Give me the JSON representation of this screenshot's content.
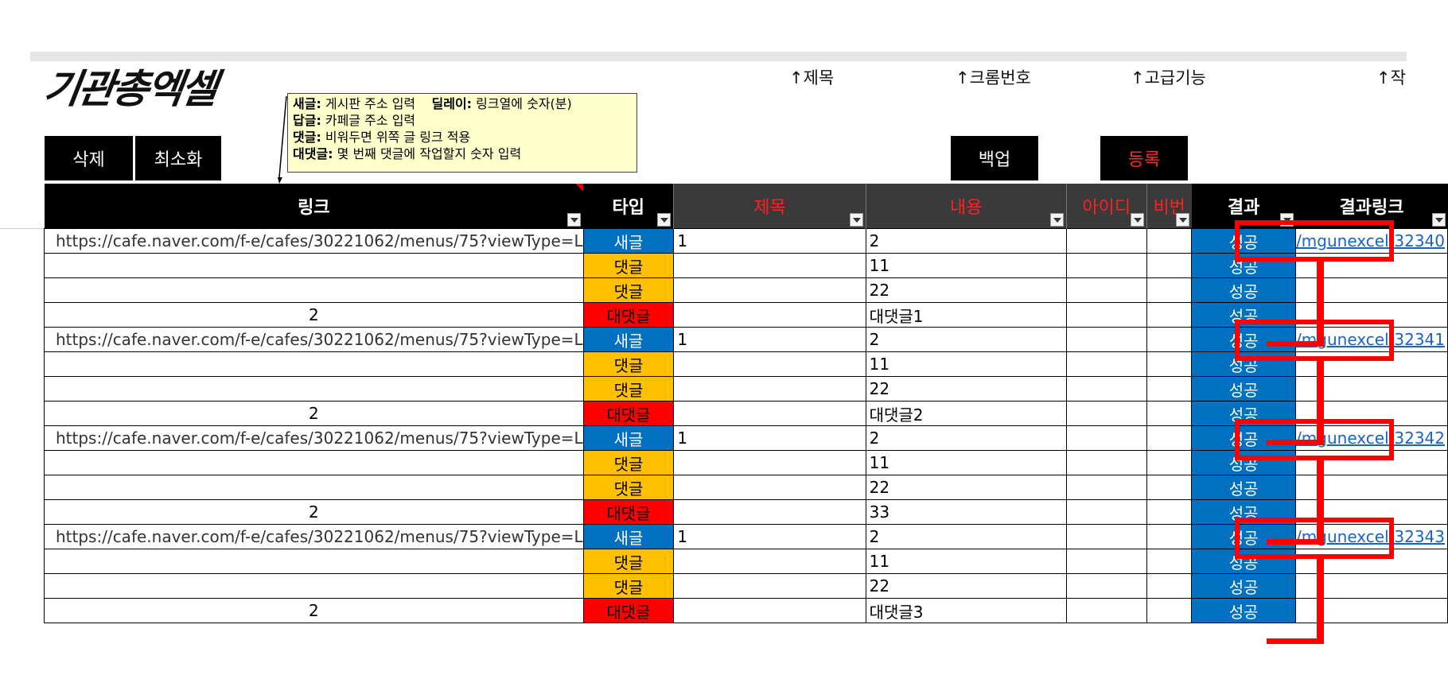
{
  "logo": "기관총엑셀",
  "hints": [
    "↑제목",
    "↑크롬번호",
    "↑고급기능",
    "↑작"
  ],
  "tooltip": [
    {
      "bold": "새글:",
      "text": " 게시판 주소 입력    ",
      "bold2": "딜레이:",
      "text2": " 링크열에 숫자(분)"
    },
    {
      "bold": "답글:",
      "text": " 카페글 주소 입력"
    },
    {
      "bold": "댓글:",
      "text": " 비워두면 위쪽 글 링크 적용"
    },
    {
      "bold": "대댓글:",
      "text": " 몇 번째 댓글에 작업할지 숫자 입력"
    }
  ],
  "buttons": {
    "delete": "삭제",
    "minimize": "최소화",
    "backup": "백업",
    "register": "등록"
  },
  "columns": [
    "링크",
    "타입",
    "제목",
    "내용",
    "아이디",
    "비번",
    "결과",
    "결과링크"
  ],
  "rows": [
    {
      "link": "https://cafe.naver.com/f-e/cafes/30221062/menus/75?viewType=L",
      "type": "새글",
      "kind": "new",
      "title": "1",
      "content": "2",
      "result": "성공",
      "rlink": "/mgunexcel/32340"
    },
    {
      "link": "",
      "type": "댓글",
      "kind": "rep",
      "title": "",
      "content": "11",
      "result": "성공",
      "rlink": ""
    },
    {
      "link": "",
      "type": "댓글",
      "kind": "rep",
      "title": "",
      "content": "22",
      "result": "성공",
      "rlink": ""
    },
    {
      "link": "2",
      "type": "대댓글",
      "kind": "sub",
      "title": "",
      "content": "대댓글1",
      "result": "성공",
      "rlink": ""
    },
    {
      "link": "https://cafe.naver.com/f-e/cafes/30221062/menus/75?viewType=L",
      "type": "새글",
      "kind": "new",
      "title": "1",
      "content": "2",
      "result": "성공",
      "rlink": "/mgunexcel/32341"
    },
    {
      "link": "",
      "type": "댓글",
      "kind": "rep",
      "title": "",
      "content": "11",
      "result": "성공",
      "rlink": ""
    },
    {
      "link": "",
      "type": "댓글",
      "kind": "rep",
      "title": "",
      "content": "22",
      "result": "성공",
      "rlink": ""
    },
    {
      "link": "2",
      "type": "대댓글",
      "kind": "sub",
      "title": "",
      "content": "대댓글2",
      "result": "성공",
      "rlink": ""
    },
    {
      "link": "https://cafe.naver.com/f-e/cafes/30221062/menus/75?viewType=L",
      "type": "새글",
      "kind": "new",
      "title": "1",
      "content": "2",
      "result": "성공",
      "rlink": "/mgunexcel/32342"
    },
    {
      "link": "",
      "type": "댓글",
      "kind": "rep",
      "title": "",
      "content": "11",
      "result": "성공",
      "rlink": ""
    },
    {
      "link": "",
      "type": "댓글",
      "kind": "rep",
      "title": "",
      "content": "22",
      "result": "성공",
      "rlink": ""
    },
    {
      "link": "2",
      "type": "대댓글",
      "kind": "sub",
      "title": "",
      "content": "33",
      "result": "성공",
      "rlink": ""
    },
    {
      "link": "https://cafe.naver.com/f-e/cafes/30221062/menus/75?viewType=L",
      "type": "새글",
      "kind": "new",
      "title": "1",
      "content": "2",
      "result": "성공",
      "rlink": "/mgunexcel/32343"
    },
    {
      "link": "",
      "type": "댓글",
      "kind": "rep",
      "title": "",
      "content": "11",
      "result": "성공",
      "rlink": ""
    },
    {
      "link": "",
      "type": "댓글",
      "kind": "rep",
      "title": "",
      "content": "22",
      "result": "성공",
      "rlink": ""
    },
    {
      "link": "2",
      "type": "대댓글",
      "kind": "sub",
      "title": "",
      "content": "대댓글3",
      "result": "성공",
      "rlink": ""
    }
  ]
}
